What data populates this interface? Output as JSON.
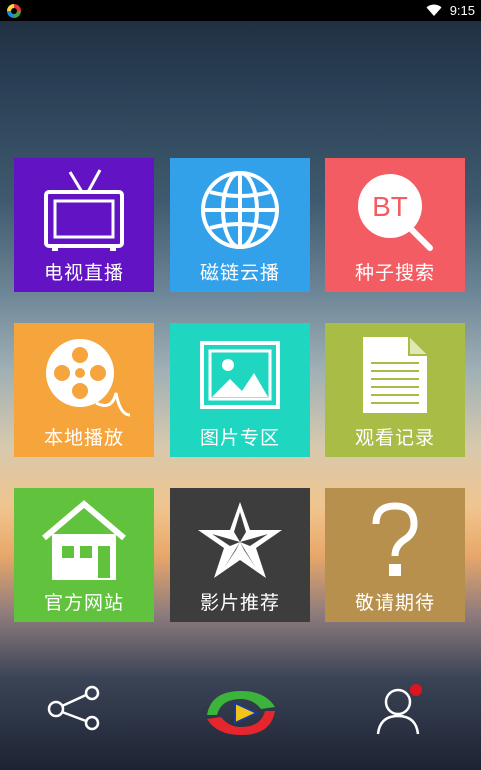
{
  "status": {
    "time": "9:15"
  },
  "tiles": [
    {
      "label": "电视直播",
      "color": "#6214c4",
      "icon": "tv-icon"
    },
    {
      "label": "磁链云播",
      "color": "#33a0ea",
      "icon": "globe-icon"
    },
    {
      "label": "种子搜索",
      "color": "#f25c62",
      "icon": "bt-search-icon",
      "icon_text": "BT"
    },
    {
      "label": "本地播放",
      "color": "#f6a43c",
      "icon": "film-reel-icon"
    },
    {
      "label": "图片专区",
      "color": "#1fd7c0",
      "icon": "picture-icon"
    },
    {
      "label": "观看记录",
      "color": "#a9bd46",
      "icon": "document-icon"
    },
    {
      "label": "官方网站",
      "color": "#60c23d",
      "icon": "house-icon"
    },
    {
      "label": "影片推荐",
      "color": "#3d3d3d",
      "icon": "star-icon"
    },
    {
      "label": "敬请期待",
      "color": "#b8904e",
      "icon": "question-icon"
    }
  ],
  "bottom": {
    "share": "share-icon",
    "logo": "app-logo-icon",
    "profile": "profile-icon",
    "notification_color": "#e0141e"
  }
}
